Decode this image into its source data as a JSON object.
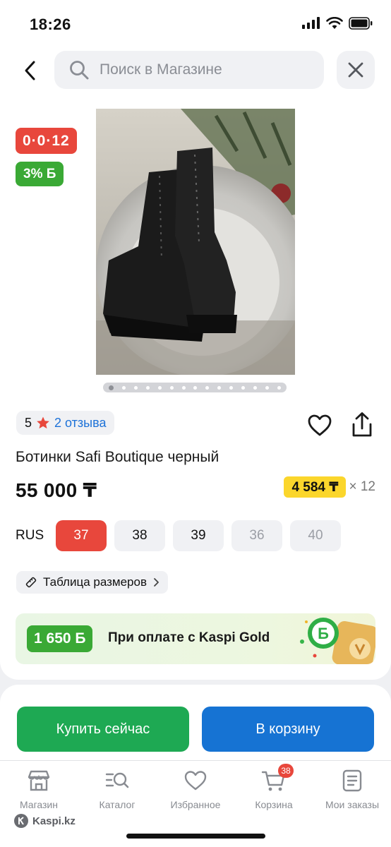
{
  "status_bar": {
    "time": "18:26"
  },
  "search": {
    "placeholder": "Поиск в Магазине"
  },
  "badges": {
    "installment": "0·0·12",
    "bonus": "3% Б"
  },
  "gallery": {
    "total": 15,
    "active_index": 0
  },
  "rating": {
    "score": "5",
    "reviews": "2 отзыва"
  },
  "product": {
    "title": "Ботинки Safi Boutique черный",
    "price": "55 000 ₸",
    "installment_price": "4 584 ₸",
    "installment_mult": "× 12"
  },
  "sizes": {
    "label": "RUS",
    "items": [
      {
        "value": "37",
        "state": "selected"
      },
      {
        "value": "38",
        "state": "available"
      },
      {
        "value": "39",
        "state": "available"
      },
      {
        "value": "36",
        "state": "disabled"
      },
      {
        "value": "40",
        "state": "disabled"
      }
    ]
  },
  "size_table": {
    "label": "Таблица размеров"
  },
  "kaspi_gold": {
    "amount": "1 650 Б",
    "text": "При оплате с Kaspi Gold"
  },
  "actions": {
    "buy": "Купить сейчас",
    "cart": "В корзину"
  },
  "tabbar": {
    "items": [
      {
        "label": "Магазин",
        "icon": "store-icon"
      },
      {
        "label": "Каталог",
        "icon": "catalog-search-icon"
      },
      {
        "label": "Избранное",
        "icon": "heart-icon"
      },
      {
        "label": "Корзина",
        "icon": "cart-icon",
        "badge": "38"
      },
      {
        "label": "Мои заказы",
        "icon": "orders-icon"
      }
    ]
  },
  "watermark": "Kaspi.kz",
  "colors": {
    "red": "#e8473c",
    "green": "#3aa935",
    "blue": "#1673d3",
    "buy_green": "#1ea953",
    "yellow": "#fbd62c"
  }
}
